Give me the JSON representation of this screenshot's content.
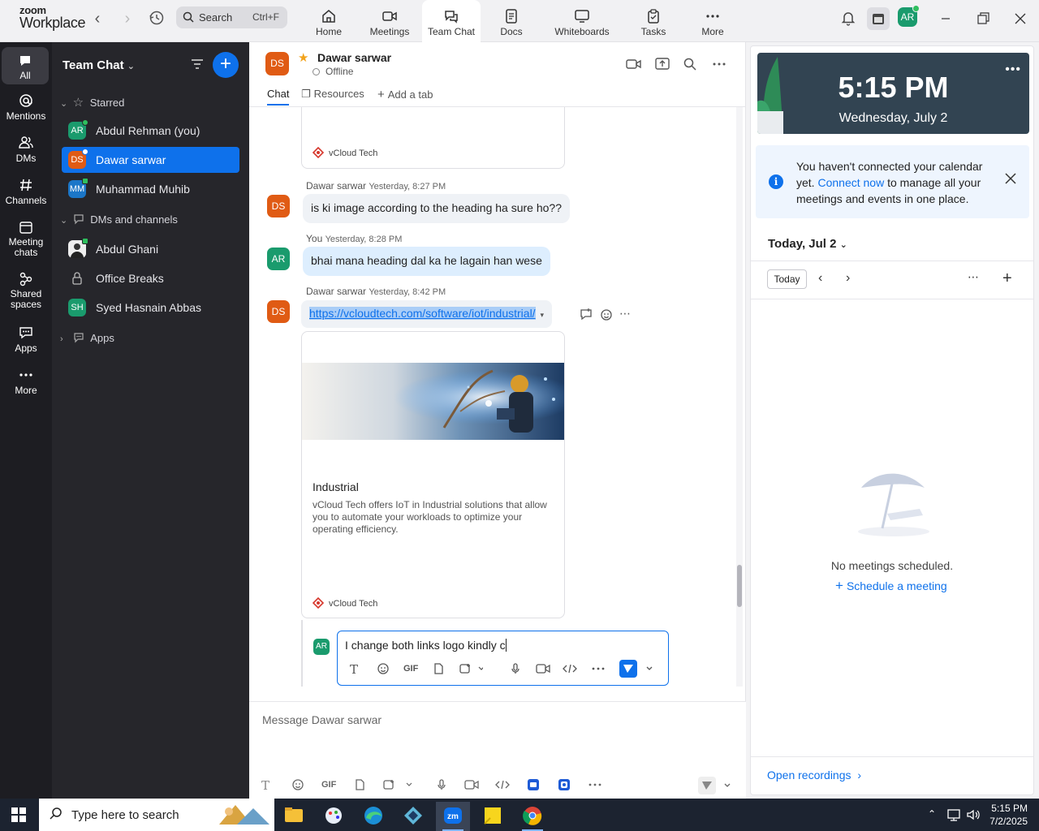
{
  "app": {
    "logo_top": "zoom",
    "logo_bottom": "Workplace",
    "search_placeholder": "Search",
    "search_shortcut": "Ctrl+F",
    "nav_tabs": [
      {
        "label": "Home",
        "icon": "home-icon"
      },
      {
        "label": "Meetings",
        "icon": "video-camera-icon"
      },
      {
        "label": "Team Chat",
        "icon": "chat-bubbles-icon",
        "active": true
      },
      {
        "label": "Docs",
        "icon": "document-icon"
      },
      {
        "label": "Whiteboards",
        "icon": "whiteboard-icon"
      },
      {
        "label": "Tasks",
        "icon": "clipboard-icon"
      },
      {
        "label": "More",
        "icon": "more-dots-icon"
      }
    ],
    "user_initials": "AR"
  },
  "rail": {
    "items": [
      {
        "label": "All"
      },
      {
        "label": "Mentions"
      },
      {
        "label": "DMs"
      },
      {
        "label": "Channels"
      },
      {
        "label": "Meeting chats"
      },
      {
        "label": "Shared spaces"
      },
      {
        "label": "Apps"
      },
      {
        "label": "More"
      }
    ]
  },
  "sidebar": {
    "title": "Team Chat",
    "starred_label": "Starred",
    "dms_label": "DMs and channels",
    "apps_label": "Apps",
    "starred": [
      {
        "initials": "AR",
        "name": "Abdul Rehman (you)",
        "color": "#1a9b6d"
      },
      {
        "initials": "DS",
        "name": "Dawar sarwar",
        "color": "#e05b14"
      },
      {
        "initials": "MM",
        "name": "Muhammad Muhib",
        "color": "#1b76c8"
      }
    ],
    "dms": [
      {
        "initials": "",
        "name": "Abdul Ghani"
      },
      {
        "initials": "",
        "name": "Office Breaks"
      },
      {
        "initials": "SH",
        "name": "Syed Hasnain Abbas",
        "color": "#1a9b6d"
      }
    ]
  },
  "chat": {
    "contact_initials": "DS",
    "contact_name": "Dawar sarwar",
    "status": "Offline",
    "tabs": {
      "chat": "Chat",
      "resources": "Resources",
      "add": "Add a tab"
    },
    "card_source": "vCloud Tech",
    "messages": [
      {
        "sender": "Dawar sarwar",
        "time": "Yesterday, 8:27 PM",
        "initials": "DS",
        "text": "is ki image according to the heading ha sure ho??"
      },
      {
        "sender": "You",
        "time": "Yesterday, 8:28 PM",
        "initials": "AR",
        "text": "bhai mana heading dal ka he lagain han wese"
      },
      {
        "sender": "Dawar sarwar",
        "time": "Yesterday, 8:42 PM",
        "initials": "DS",
        "link": "https://vcloudtech.com/software/iot/industrial/"
      }
    ],
    "preview": {
      "title": "Industrial",
      "description": "vCloud Tech offers IoT in Industrial solutions that allow you to automate your workloads to optimize your operating efficiency.",
      "source": "vCloud Tech"
    },
    "edit_initials": "AR",
    "edit_text": "I change both links logo kindly c",
    "compose_placeholder": "Message Dawar sarwar",
    "toolbar": {
      "gif": "GIF"
    }
  },
  "right_panel": {
    "time": "5:15 PM",
    "date": "Wednesday, July 2",
    "notice_pre": "You haven't connected your calendar yet.",
    "notice_link": "Connect now",
    "notice_post": "to manage all your meetings and events in one place.",
    "day_heading": "Today, Jul 2",
    "today_button": "Today",
    "no_meetings": "No meetings scheduled.",
    "schedule": "Schedule a meeting",
    "open_recordings": "Open recordings"
  },
  "taskbar": {
    "search_placeholder": "Type here to search",
    "time": "5:15 PM",
    "date": "7/2/2025"
  }
}
